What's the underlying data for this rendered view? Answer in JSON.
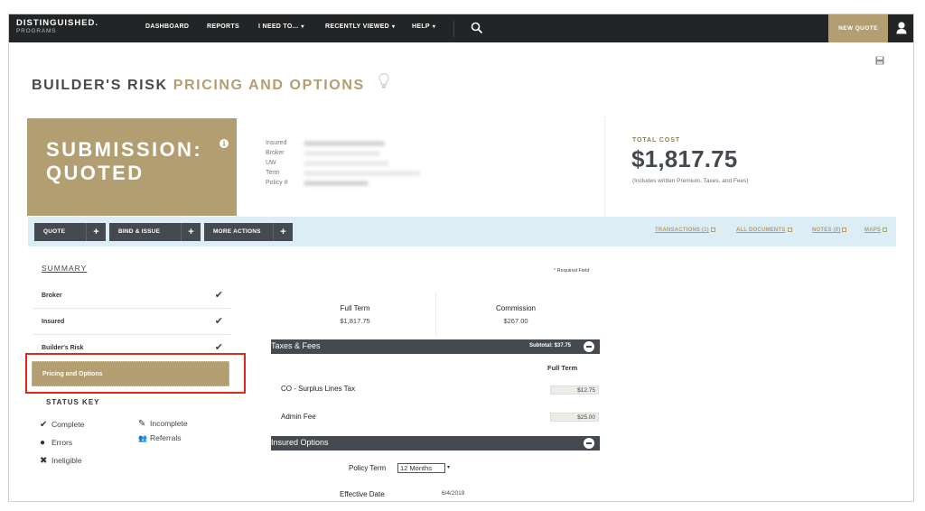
{
  "nav": {
    "logo_line1": "DISTINGUISHED.",
    "logo_line2": "PROGRAMS",
    "items": [
      {
        "label": "DASHBOARD",
        "dropdown": false
      },
      {
        "label": "REPORTS",
        "dropdown": false
      },
      {
        "label": "I NEED TO...",
        "dropdown": true
      },
      {
        "label": "RECENTLY VIEWED",
        "dropdown": true
      },
      {
        "label": "HELP",
        "dropdown": true
      }
    ],
    "caret": "▾",
    "search_icon": "search-icon",
    "new_quote_label": "NEW QUOTE",
    "user_icon": "user-icon"
  },
  "page": {
    "title_part1": "BUILDER'S RISK",
    "title_part2": "PRICING AND OPTIONS",
    "title_icon": "lightbulb-icon",
    "save_icon": "save-icon"
  },
  "submission": {
    "status_line1": "SUBMISSION:",
    "status_line2": "QUOTED",
    "info_icon": "i",
    "meta_labels": [
      "Insured",
      "Broker",
      "UW",
      "Term",
      "Policy #"
    ]
  },
  "total": {
    "label": "TOTAL COST",
    "value": "$1,817.75",
    "note": "(Includes written Premium, Taxes, and Fees)"
  },
  "actions": {
    "buttons": [
      {
        "label": "QUOTE",
        "icon": "+"
      },
      {
        "label": "BIND & ISSUE",
        "icon": "+"
      },
      {
        "label": "MORE ACTIONS",
        "icon": "+"
      }
    ],
    "links": [
      {
        "label": "TRANSACTIONS (1)"
      },
      {
        "label": "ALL DOCUMENTS"
      },
      {
        "label": "NOTES (0)"
      },
      {
        "label": "MAPS"
      }
    ]
  },
  "sidebar": {
    "summary_label": "SUMMARY",
    "items": [
      {
        "label": "Broker",
        "status": "✔"
      },
      {
        "label": "Insured",
        "status": "✔"
      },
      {
        "label": "Builder's Risk",
        "status": "✔"
      }
    ],
    "active_item": "Pricing and Options",
    "status_key_title": "STATUS KEY",
    "status_key": [
      {
        "icon": "✔",
        "label": "Complete"
      },
      {
        "icon": "●",
        "label": "Errors"
      },
      {
        "icon": "✖",
        "label": "Ineligible"
      },
      {
        "icon": "✎",
        "label": "Incomplete"
      },
      {
        "icon": "👥",
        "label": "Referrals"
      }
    ]
  },
  "main": {
    "required_note": "Required Field",
    "required_star": "*",
    "summary_cols": [
      {
        "label": "Full Term",
        "value": "$1,817.75"
      },
      {
        "label": "Commission",
        "value": "$267.00"
      }
    ],
    "taxes": {
      "title": "Taxes & Fees",
      "subtotal": "Subtotal: $37.75",
      "column_label": "Full Term",
      "rows": [
        {
          "name": "CO - Surplus Lines Tax",
          "value": "$12.75"
        },
        {
          "name": "Admin Fee",
          "value": "$25.00"
        }
      ]
    },
    "options": {
      "title": "Insured Options",
      "policy_term_label": "Policy Term",
      "policy_term_value": "12 Months",
      "effective_date_label": "Effective Date",
      "effective_date_value": "6/4/2019"
    }
  }
}
